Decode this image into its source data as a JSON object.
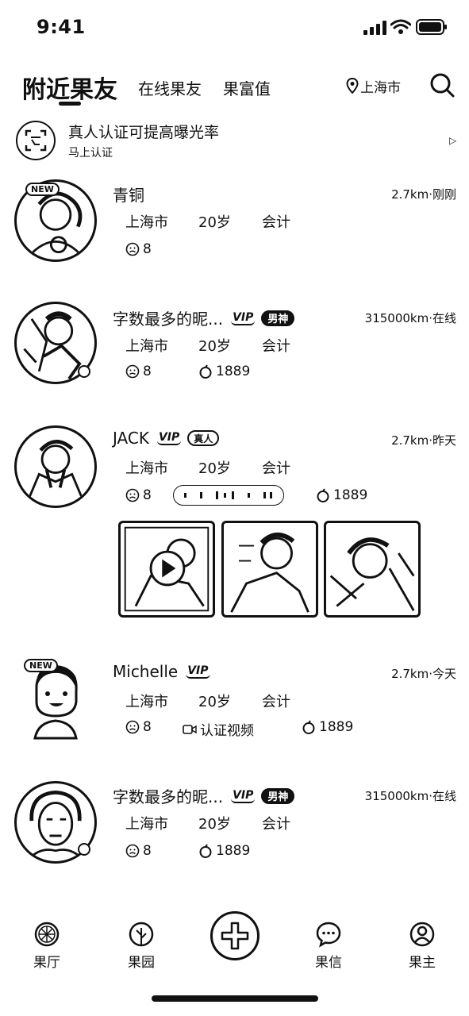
{
  "status_bar": {
    "time": "9:41"
  },
  "header": {
    "tab_active": "附近果友",
    "tab_online": "在线果友",
    "tab_rich": "果富值",
    "location": "上海市"
  },
  "verify_banner": {
    "title": "真人认证可提高曝光率",
    "subtitle": "马上认证"
  },
  "users": [
    {
      "name": "青铜",
      "distance": "2.7km·刚刚",
      "city": "上海市",
      "age": "20岁",
      "job": "会计",
      "likes": "8",
      "vip": "",
      "god": "",
      "real": "",
      "fruit": "",
      "video": ""
    },
    {
      "name": "字数最多的昵...",
      "distance": "315000km·在线",
      "city": "上海市",
      "age": "20岁",
      "job": "会计",
      "likes": "8",
      "vip": "VIP",
      "god": "男神",
      "real": "",
      "fruit": "1889",
      "video": ""
    },
    {
      "name": "JACK",
      "distance": "2.7km·昨天",
      "city": "上海市",
      "age": "20岁",
      "job": "会计",
      "likes": "8",
      "vip": "VIP",
      "god": "",
      "real": "真人",
      "fruit": "1889",
      "video": ""
    },
    {
      "name": "Michelle",
      "distance": "2.7km·今天",
      "city": "上海市",
      "age": "20岁",
      "job": "会计",
      "likes": "8",
      "vip": "VIP",
      "god": "",
      "real": "",
      "fruit": "1889",
      "video": "认证视频"
    },
    {
      "name": "字数最多的昵...",
      "distance": "315000km·在线",
      "city": "上海市",
      "age": "20岁",
      "job": "会计",
      "likes": "8",
      "vip": "VIP",
      "god": "男神",
      "real": "",
      "fruit": "1889",
      "video": ""
    }
  ],
  "bottom_nav": {
    "hall": "果厅",
    "garden": "果园",
    "messages": "果信",
    "profile": "果主"
  }
}
